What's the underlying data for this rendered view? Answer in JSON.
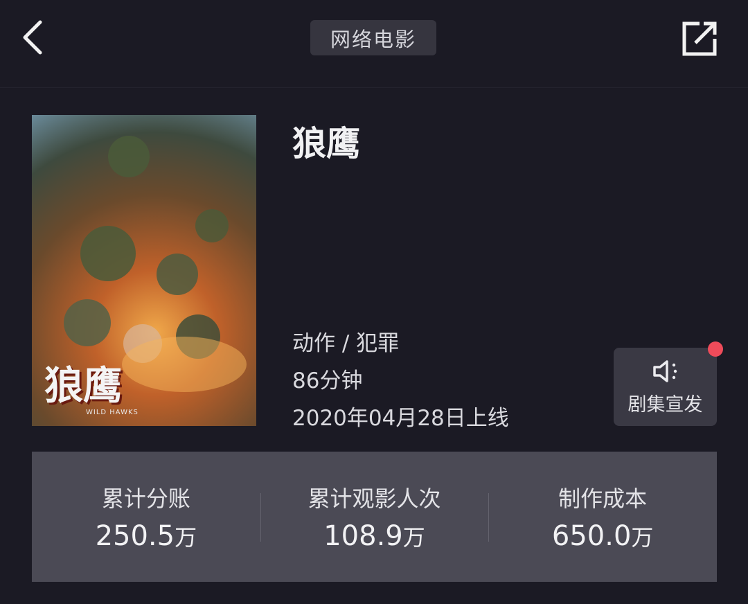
{
  "header": {
    "title": "网络电影"
  },
  "movie": {
    "title": "狼鹰",
    "poster_title": "狼鹰",
    "poster_subtitle": "WILD HAWKS",
    "genre": "动作 / 犯罪",
    "duration": "86分钟",
    "release": "2020年04月28日上线"
  },
  "promo": {
    "label": "剧集宣发",
    "icon": "megaphone-icon",
    "badge_color": "#ef4b5a"
  },
  "stats": [
    {
      "label": "累计分账",
      "value": "250.5",
      "unit": "万"
    },
    {
      "label": "累计观影人次",
      "value": "108.9",
      "unit": "万"
    },
    {
      "label": "制作成本",
      "value": "650.0",
      "unit": "万"
    }
  ]
}
